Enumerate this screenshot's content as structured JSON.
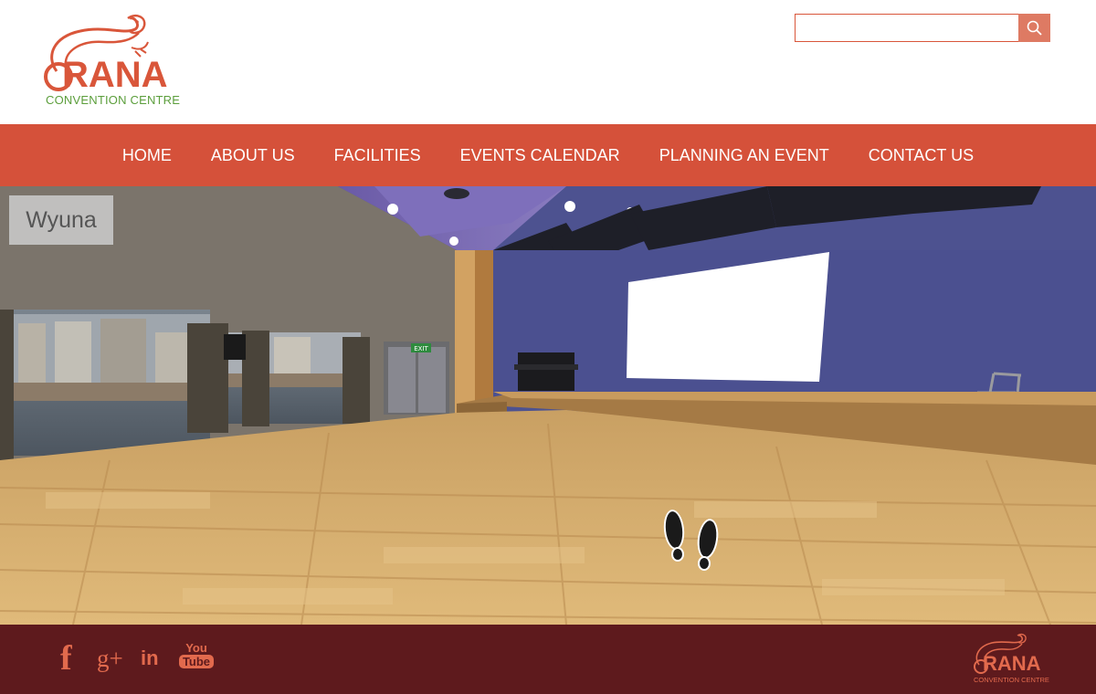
{
  "brand": {
    "logo_word": "RANA",
    "logo_sub": "CONVENTION CENTRE",
    "primary_color": "#d5513a",
    "secondary_color": "#5b9e3b",
    "footer_color": "#5e1a1d"
  },
  "search": {
    "placeholder": "",
    "value": "",
    "icon": "search-icon"
  },
  "nav": {
    "items": [
      {
        "label": "HOME"
      },
      {
        "label": "ABOUT US"
      },
      {
        "label": "FACILITIES"
      },
      {
        "label": "EVENTS CALENDAR"
      },
      {
        "label": "PLANNING AN EVENT"
      },
      {
        "label": "CONTACT US"
      }
    ]
  },
  "scene": {
    "room_label": "Wyuna",
    "exit_sign": "EXIT"
  },
  "footer": {
    "social": {
      "facebook": "f",
      "googleplus": "g+",
      "linkedin": "in",
      "youtube_top": "You",
      "youtube_bottom": "Tube"
    },
    "logo_word": "RANA",
    "logo_sub": "CONVENTION CENTRE"
  }
}
